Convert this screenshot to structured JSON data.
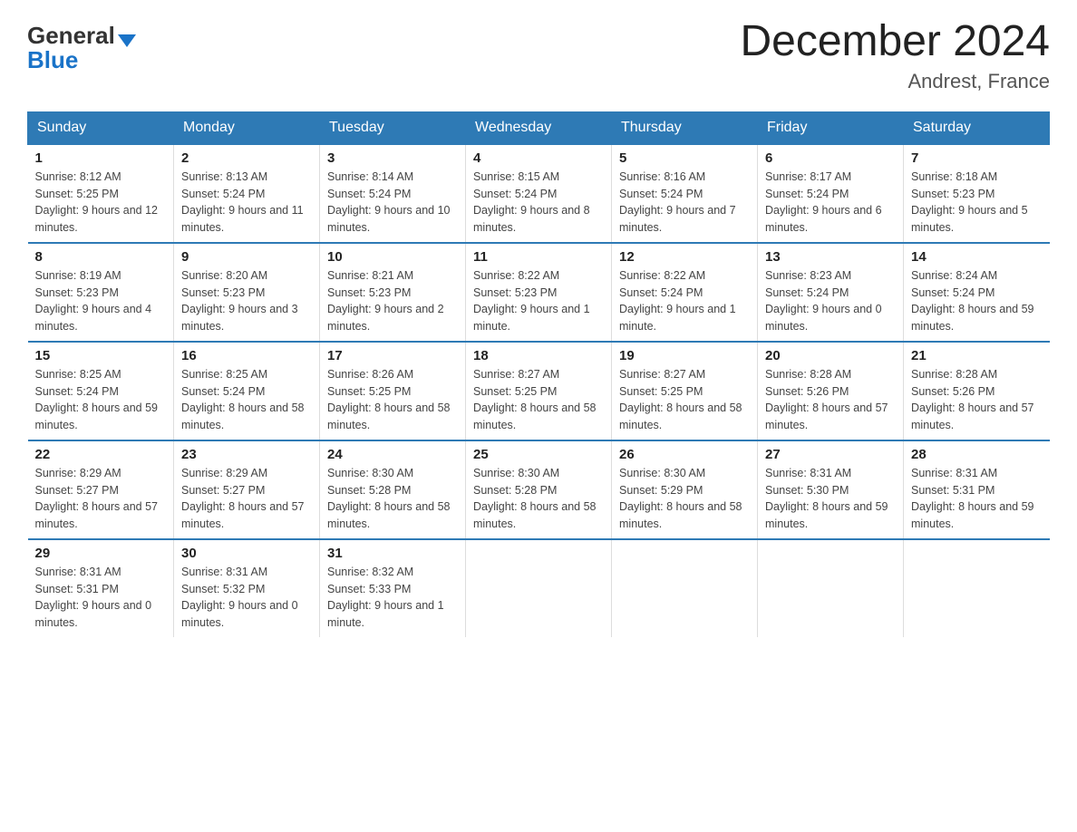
{
  "header": {
    "logo_general": "General",
    "logo_blue": "Blue",
    "main_title": "December 2024",
    "subtitle": "Andrest, France"
  },
  "weekdays": [
    "Sunday",
    "Monday",
    "Tuesday",
    "Wednesday",
    "Thursday",
    "Friday",
    "Saturday"
  ],
  "weeks": [
    [
      {
        "day": "1",
        "sunrise": "8:12 AM",
        "sunset": "5:25 PM",
        "daylight": "9 hours and 12 minutes."
      },
      {
        "day": "2",
        "sunrise": "8:13 AM",
        "sunset": "5:24 PM",
        "daylight": "9 hours and 11 minutes."
      },
      {
        "day": "3",
        "sunrise": "8:14 AM",
        "sunset": "5:24 PM",
        "daylight": "9 hours and 10 minutes."
      },
      {
        "day": "4",
        "sunrise": "8:15 AM",
        "sunset": "5:24 PM",
        "daylight": "9 hours and 8 minutes."
      },
      {
        "day": "5",
        "sunrise": "8:16 AM",
        "sunset": "5:24 PM",
        "daylight": "9 hours and 7 minutes."
      },
      {
        "day": "6",
        "sunrise": "8:17 AM",
        "sunset": "5:24 PM",
        "daylight": "9 hours and 6 minutes."
      },
      {
        "day": "7",
        "sunrise": "8:18 AM",
        "sunset": "5:23 PM",
        "daylight": "9 hours and 5 minutes."
      }
    ],
    [
      {
        "day": "8",
        "sunrise": "8:19 AM",
        "sunset": "5:23 PM",
        "daylight": "9 hours and 4 minutes."
      },
      {
        "day": "9",
        "sunrise": "8:20 AM",
        "sunset": "5:23 PM",
        "daylight": "9 hours and 3 minutes."
      },
      {
        "day": "10",
        "sunrise": "8:21 AM",
        "sunset": "5:23 PM",
        "daylight": "9 hours and 2 minutes."
      },
      {
        "day": "11",
        "sunrise": "8:22 AM",
        "sunset": "5:23 PM",
        "daylight": "9 hours and 1 minute."
      },
      {
        "day": "12",
        "sunrise": "8:22 AM",
        "sunset": "5:24 PM",
        "daylight": "9 hours and 1 minute."
      },
      {
        "day": "13",
        "sunrise": "8:23 AM",
        "sunset": "5:24 PM",
        "daylight": "9 hours and 0 minutes."
      },
      {
        "day": "14",
        "sunrise": "8:24 AM",
        "sunset": "5:24 PM",
        "daylight": "8 hours and 59 minutes."
      }
    ],
    [
      {
        "day": "15",
        "sunrise": "8:25 AM",
        "sunset": "5:24 PM",
        "daylight": "8 hours and 59 minutes."
      },
      {
        "day": "16",
        "sunrise": "8:25 AM",
        "sunset": "5:24 PM",
        "daylight": "8 hours and 58 minutes."
      },
      {
        "day": "17",
        "sunrise": "8:26 AM",
        "sunset": "5:25 PM",
        "daylight": "8 hours and 58 minutes."
      },
      {
        "day": "18",
        "sunrise": "8:27 AM",
        "sunset": "5:25 PM",
        "daylight": "8 hours and 58 minutes."
      },
      {
        "day": "19",
        "sunrise": "8:27 AM",
        "sunset": "5:25 PM",
        "daylight": "8 hours and 58 minutes."
      },
      {
        "day": "20",
        "sunrise": "8:28 AM",
        "sunset": "5:26 PM",
        "daylight": "8 hours and 57 minutes."
      },
      {
        "day": "21",
        "sunrise": "8:28 AM",
        "sunset": "5:26 PM",
        "daylight": "8 hours and 57 minutes."
      }
    ],
    [
      {
        "day": "22",
        "sunrise": "8:29 AM",
        "sunset": "5:27 PM",
        "daylight": "8 hours and 57 minutes."
      },
      {
        "day": "23",
        "sunrise": "8:29 AM",
        "sunset": "5:27 PM",
        "daylight": "8 hours and 57 minutes."
      },
      {
        "day": "24",
        "sunrise": "8:30 AM",
        "sunset": "5:28 PM",
        "daylight": "8 hours and 58 minutes."
      },
      {
        "day": "25",
        "sunrise": "8:30 AM",
        "sunset": "5:28 PM",
        "daylight": "8 hours and 58 minutes."
      },
      {
        "day": "26",
        "sunrise": "8:30 AM",
        "sunset": "5:29 PM",
        "daylight": "8 hours and 58 minutes."
      },
      {
        "day": "27",
        "sunrise": "8:31 AM",
        "sunset": "5:30 PM",
        "daylight": "8 hours and 59 minutes."
      },
      {
        "day": "28",
        "sunrise": "8:31 AM",
        "sunset": "5:31 PM",
        "daylight": "8 hours and 59 minutes."
      }
    ],
    [
      {
        "day": "29",
        "sunrise": "8:31 AM",
        "sunset": "5:31 PM",
        "daylight": "9 hours and 0 minutes."
      },
      {
        "day": "30",
        "sunrise": "8:31 AM",
        "sunset": "5:32 PM",
        "daylight": "9 hours and 0 minutes."
      },
      {
        "day": "31",
        "sunrise": "8:32 AM",
        "sunset": "5:33 PM",
        "daylight": "9 hours and 1 minute."
      },
      null,
      null,
      null,
      null
    ]
  ]
}
